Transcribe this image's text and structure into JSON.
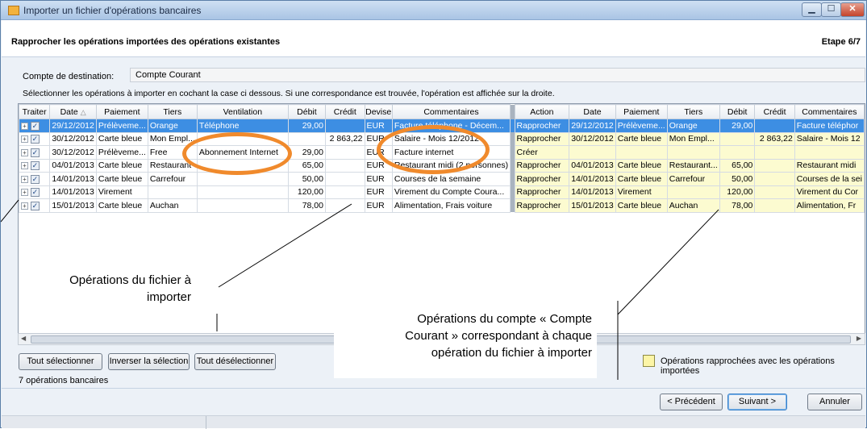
{
  "window": {
    "title": "Importer un fichier d'opérations bancaires"
  },
  "header": {
    "step_title": "Rapprocher les opérations importées des opérations existantes",
    "step_number": "Etape 6/7"
  },
  "account": {
    "label": "Compte de destination:",
    "value": "Compte Courant"
  },
  "instructions": "Sélectionner les opérations à importer en cochant la case ci dessous. Si une correspondance est trouvée, l'opération est affichée sur la droite.",
  "table": {
    "columns_left": [
      "Traiter",
      "Date",
      "Paiement",
      "Tiers",
      "Ventilation",
      "Débit",
      "Crédit",
      "Devise",
      "Commentaires"
    ],
    "sort_indicator": "△",
    "columns_right": [
      "Action",
      "Date",
      "Paiement",
      "Tiers",
      "Débit",
      "Crédit",
      "Commentaires"
    ],
    "rows": [
      {
        "date": "29/12/2012",
        "paiement": "Prélèveme...",
        "tiers": "Orange",
        "ventilation": "Téléphone",
        "debit": "29,00",
        "credit": "",
        "devise": "EUR",
        "commentaires": "Facture téléphone - Décem...",
        "action": "Rapprocher",
        "r_date": "29/12/2012",
        "r_paiement": "Prélèveme...",
        "r_tiers": "Orange",
        "r_debit": "29,00",
        "r_credit": "",
        "r_commentaires": "Facture téléphor"
      },
      {
        "date": "30/12/2012",
        "paiement": "Carte bleue",
        "tiers": "Mon Empl...",
        "ventilation": "",
        "debit": "",
        "credit": "2 863,22",
        "devise": "EUR",
        "commentaires": "Salaire - Mois 12/2012",
        "action": "Rapprocher",
        "r_date": "30/12/2012",
        "r_paiement": "Carte bleue",
        "r_tiers": "Mon Empl...",
        "r_debit": "",
        "r_credit": "2 863,22",
        "r_commentaires": "Salaire - Mois 12"
      },
      {
        "date": "30/12/2012",
        "paiement": "Prélèveme...",
        "tiers": "Free",
        "ventilation": "Abonnement Internet",
        "debit": "29,00",
        "credit": "",
        "devise": "EUR",
        "commentaires": "Facture internet",
        "action": "Créer",
        "r_date": "",
        "r_paiement": "",
        "r_tiers": "",
        "r_debit": "",
        "r_credit": "",
        "r_commentaires": ""
      },
      {
        "date": "04/01/2013",
        "paiement": "Carte bleue",
        "tiers": "Restaurant",
        "ventilation": "",
        "debit": "65,00",
        "credit": "",
        "devise": "EUR",
        "commentaires": "Restaurant midi (2 personnes)",
        "action": "Rapprocher",
        "r_date": "04/01/2013",
        "r_paiement": "Carte bleue",
        "r_tiers": "Restaurant...",
        "r_debit": "65,00",
        "r_credit": "",
        "r_commentaires": "Restaurant midi"
      },
      {
        "date": "14/01/2013",
        "paiement": "Carte bleue",
        "tiers": "Carrefour",
        "ventilation": "",
        "debit": "50,00",
        "credit": "",
        "devise": "EUR",
        "commentaires": "Courses de la semaine",
        "action": "Rapprocher",
        "r_date": "14/01/2013",
        "r_paiement": "Carte bleue",
        "r_tiers": "Carrefour",
        "r_debit": "50,00",
        "r_credit": "",
        "r_commentaires": "Courses de la sei"
      },
      {
        "date": "14/01/2013",
        "paiement": "Virement",
        "tiers": "",
        "ventilation": "",
        "debit": "120,00",
        "credit": "",
        "devise": "EUR",
        "commentaires": "Virement du Compte Coura...",
        "action": "Rapprocher",
        "r_date": "14/01/2013",
        "r_paiement": "Virement",
        "r_tiers": "",
        "r_debit": "120,00",
        "r_credit": "",
        "r_commentaires": "Virement du Cor"
      },
      {
        "date": "15/01/2013",
        "paiement": "Carte bleue",
        "tiers": "Auchan",
        "ventilation": "",
        "debit": "78,00",
        "credit": "",
        "devise": "EUR",
        "commentaires": "Alimentation, Frais voiture",
        "action": "Rapprocher",
        "r_date": "15/01/2013",
        "r_paiement": "Carte bleue",
        "r_tiers": "Auchan",
        "r_debit": "78,00",
        "r_credit": "",
        "r_commentaires": "Alimentation, Fr"
      }
    ]
  },
  "buttons": {
    "select_all": "Tout sélectionner",
    "invert": "Inverser la sélection",
    "deselect_all": "Tout désélectionner",
    "previous": "< Précédent",
    "next": "Suivant >",
    "cancel": "Annuler"
  },
  "legend": "Opérations rapprochées avec les opérations importées",
  "count": "7 opérations bancaires",
  "callouts": {
    "import": [
      "Opérations du fichier à",
      "importer"
    ],
    "account": [
      "Opérations du compte « Compte",
      "Courant » correspondant à chaque",
      "opération du fichier à importer"
    ]
  },
  "colors": {
    "selected_row": "#3d8ee3",
    "reconciled": "#fcfbd0",
    "annotation_circle": "#f08a2c"
  }
}
